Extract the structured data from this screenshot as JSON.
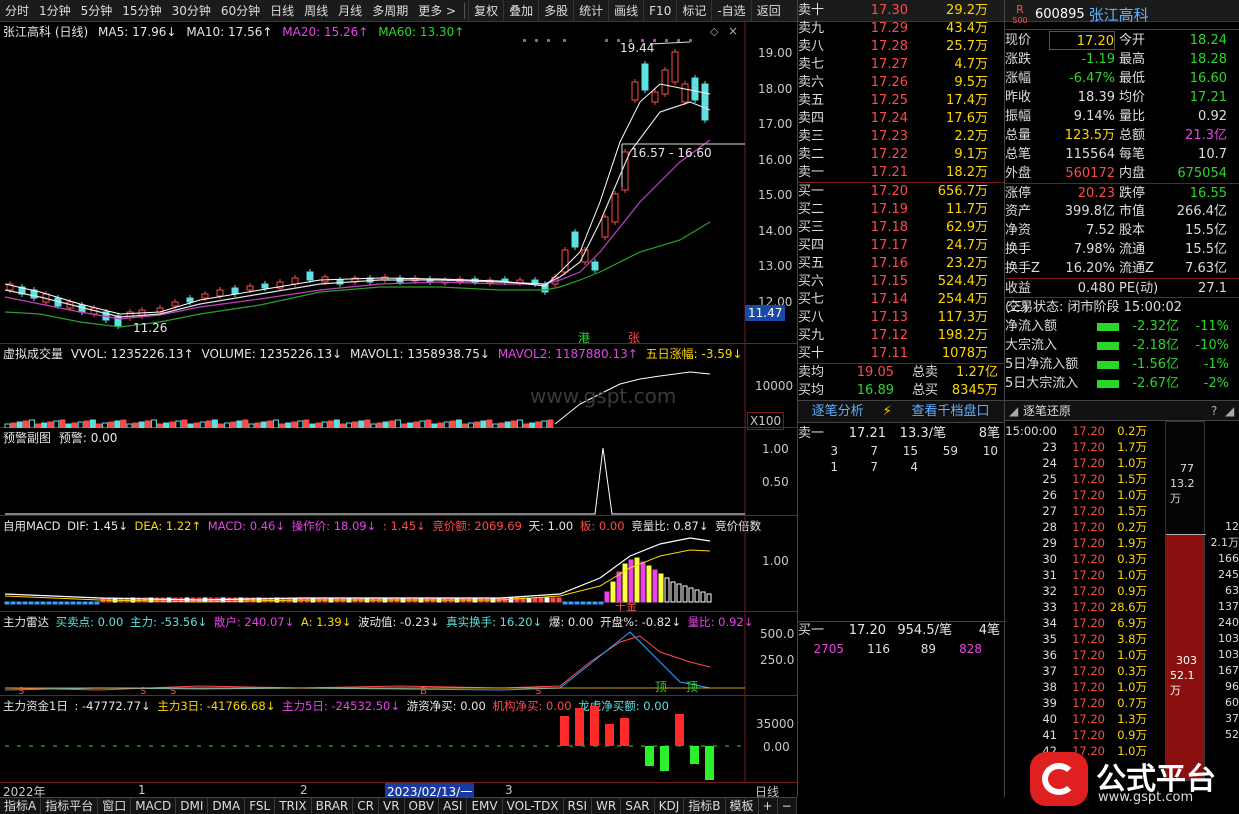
{
  "toolbar": {
    "periods": [
      "分时",
      "1分钟",
      "5分钟",
      "15分钟",
      "30分钟",
      "60分钟",
      "日线",
      "周线",
      "月线",
      "多周期",
      "更多 >"
    ],
    "actions": [
      "复权",
      "叠加",
      "多股",
      "统计",
      "画线",
      "F10",
      "标记",
      "-自选",
      "返回"
    ]
  },
  "main_chart": {
    "title": "张江高科 (日线)",
    "ma5": "MA5: 17.96↓",
    "ma10": "MA10: 17.56↑",
    "ma20": "MA20: 15.26↑",
    "ma60": "MA60: 13.30↑",
    "high_label": "19.44",
    "range_label": "16.57 - 16.60",
    "low_label": "11.26",
    "current_price_tag": "11.47",
    "badge1": "港",
    "badge2": "张",
    "y_ticks": [
      "19.00",
      "18.00",
      "17.00",
      "16.00",
      "15.00",
      "14.00",
      "13.00",
      "12.00"
    ]
  },
  "volume_panel": {
    "title": "虚拟成交量",
    "vvol": "VVOL: 1235226.13↑",
    "volume": "VOLUME: 1235226.13↓",
    "mavol1": "MAVOL1: 1358938.75↓",
    "mavol2": "MAVOL2: 1187880.13↑",
    "five_day": "五日涨幅: -3.59↓",
    "y_tick": "10000",
    "multiplier": "X100",
    "watermark": "www.gspt.com"
  },
  "alert_panel": {
    "title": "预警副图",
    "value": "预警: 0.00",
    "y_ticks": [
      "1.00",
      "0.50"
    ]
  },
  "macd_panel": {
    "title": "自用MACD",
    "dif": "DIF: 1.45↓",
    "dea": "DEA: 1.22↑",
    "macd": "MACD: 0.46↓",
    "op_price": "操作价: 18.09↓",
    "x1": ": 1.45↓",
    "bid_amount": "竞价额: 2069.69",
    "day": "天: 1.00",
    "board": "板: 0.00",
    "vol_ratio": "竞量比: 0.87↓",
    "bid_mult": "竞价倍数",
    "y_tick": "1.00",
    "tag": "千金"
  },
  "radar_panel": {
    "title": "主力雷达",
    "buy_sell": "买卖点: 0.00",
    "main": "主力: -53.56↓",
    "retail": "散户: 240.07↓",
    "a": "A: 1.39↓",
    "wave": "波动值: -0.23↓",
    "real_turnover": "真实换手: 16.20↓",
    "burst": "爆: 0.00",
    "open_pct": "开盘%: -0.82↓",
    "vol_ratio": "量比: 0.92↓",
    "y_ticks": [
      "500.0",
      "250.0"
    ],
    "sign": "顶"
  },
  "fund_panel": {
    "title": "主力资金1日",
    "d1": ": -47772.77↓",
    "d3": "主力3日: -41766.68↓",
    "d5": "主力5日: -24532.50↓",
    "hot": "游资净买: 0.00",
    "inst": "机构净买: 0.00",
    "dragon": "龙虎净买额: 0.00",
    "y_ticks": [
      "35000",
      "0.00"
    ]
  },
  "x_axis": {
    "year": "2022年",
    "m1": "1",
    "m2": "2",
    "cursor_date": "2023/02/13/一",
    "m3": "3",
    "period": "日线"
  },
  "orderbook": {
    "sells": [
      {
        "name": "卖十",
        "price": "17.30",
        "vol": "29.2万"
      },
      {
        "name": "卖九",
        "price": "17.29",
        "vol": "43.4万"
      },
      {
        "name": "卖八",
        "price": "17.28",
        "vol": "25.7万"
      },
      {
        "name": "卖七",
        "price": "17.27",
        "vol": "4.7万"
      },
      {
        "name": "卖六",
        "price": "17.26",
        "vol": "9.5万"
      },
      {
        "name": "卖五",
        "price": "17.25",
        "vol": "17.4万"
      },
      {
        "name": "卖四",
        "price": "17.24",
        "vol": "17.6万"
      },
      {
        "name": "卖三",
        "price": "17.23",
        "vol": "2.2万"
      },
      {
        "name": "卖二",
        "price": "17.22",
        "vol": "9.1万"
      },
      {
        "name": "卖一",
        "price": "17.21",
        "vol": "18.2万"
      }
    ],
    "buys": [
      {
        "name": "买一",
        "price": "17.20",
        "vol": "656.7万"
      },
      {
        "name": "买二",
        "price": "17.19",
        "vol": "11.7万"
      },
      {
        "name": "买三",
        "price": "17.18",
        "vol": "62.9万"
      },
      {
        "name": "买四",
        "price": "17.17",
        "vol": "24.7万"
      },
      {
        "name": "买五",
        "price": "17.16",
        "vol": "23.2万"
      },
      {
        "name": "买六",
        "price": "17.15",
        "vol": "524.4万"
      },
      {
        "name": "买七",
        "price": "17.14",
        "vol": "254.4万"
      },
      {
        "name": "买八",
        "price": "17.13",
        "vol": "117.3万"
      },
      {
        "name": "买九",
        "price": "17.12",
        "vol": "198.2万"
      },
      {
        "name": "买十",
        "price": "17.11",
        "vol": "1078万"
      }
    ],
    "avg_sell_label": "卖均",
    "avg_sell": "19.05",
    "total_sell_label": "总卖",
    "total_sell": "1.27亿",
    "avg_buy_label": "买均",
    "avg_buy": "16.89",
    "total_buy_label": "总买",
    "total_buy": "8345万"
  },
  "stock_info": {
    "code": "600895",
    "name": "张江高科",
    "r_badge": "R",
    "r_sub": "500",
    "rows": [
      {
        "k1": "现价",
        "v1": "17.20",
        "k2": "今开",
        "v2": "18.24"
      },
      {
        "k1": "涨跌",
        "v1": "-1.19",
        "k2": "最高",
        "v2": "18.28"
      },
      {
        "k1": "涨幅",
        "v1": "-6.47%",
        "k2": "最低",
        "v2": "16.60"
      },
      {
        "k1": "昨收",
        "v1": "18.39",
        "k2": "均价",
        "v2": "17.21"
      },
      {
        "k1": "振幅",
        "v1": "9.14%",
        "k2": "量比",
        "v2": "0.92"
      },
      {
        "k1": "总量",
        "v1": "123.5万",
        "k2": "总额",
        "v2": "21.3亿"
      },
      {
        "k1": "总笔",
        "v1": "115564",
        "k2": "每笔",
        "v2": "10.7"
      },
      {
        "k1": "外盘",
        "v1": "560172",
        "k2": "内盘",
        "v2": "675054"
      },
      {
        "k1": "涨停",
        "v1": "20.23",
        "k2": "跌停",
        "v2": "16.55"
      },
      {
        "k1": "资产",
        "v1": "399.8亿",
        "k2": "市值",
        "v2": "266.4亿"
      },
      {
        "k1": "净资",
        "v1": "7.52",
        "k2": "股本",
        "v2": "15.5亿"
      },
      {
        "k1": "换手",
        "v1": "7.98%",
        "k2": "流通",
        "v2": "15.5亿"
      },
      {
        "k1": "换手Z",
        "v1": "16.20%",
        "k2": "流通Z",
        "v2": "7.63亿"
      },
      {
        "k1": "收益(三)",
        "v1": "0.480",
        "k2": "PE(动)",
        "v2": "27.1"
      }
    ],
    "trade_status": "交易状态: 闭市阶段 15:00:02",
    "flows": [
      {
        "label": "净流入额",
        "val": "-2.32亿",
        "pct": "-11%"
      },
      {
        "label": "大宗流入",
        "val": "-2.18亿",
        "pct": "-10%"
      },
      {
        "label": "5日净流入额",
        "val": "-1.56亿",
        "pct": "-1%"
      },
      {
        "label": "5日大宗流入",
        "val": "-2.67亿",
        "pct": "-2%"
      }
    ]
  },
  "tick_analysis": {
    "tab1": "逐笔分析",
    "tab2": "查看千档盘口",
    "sell1_label": "卖一",
    "sell1_price": "17.21",
    "sell1_vol": "13.3/笔",
    "sell1_count": "8笔",
    "sell_queue1": [
      "3",
      "7",
      "15",
      "59",
      "10"
    ],
    "sell_queue2": [
      "1",
      "7",
      "4"
    ],
    "buy1_label": "买一",
    "buy1_price": "17.20",
    "buy1_vol": "954.5/笔",
    "buy1_count": "4笔",
    "buy_queue": [
      "2705",
      "116",
      "89",
      "828"
    ]
  },
  "tick_restore": {
    "title": "逐笔还原",
    "rows": [
      {
        "t": "15:00:00",
        "p": "17.20",
        "v": "0.2万"
      },
      {
        "t": "23",
        "p": "17.20",
        "v": "1.7万"
      },
      {
        "t": "24",
        "p": "17.20",
        "v": "1.0万"
      },
      {
        "t": "25",
        "p": "17.20",
        "v": "1.5万"
      },
      {
        "t": "26",
        "p": "17.20",
        "v": "1.0万"
      },
      {
        "t": "27",
        "p": "17.20",
        "v": "1.5万"
      },
      {
        "t": "28",
        "p": "17.20",
        "v": "0.2万"
      },
      {
        "t": "29",
        "p": "17.20",
        "v": "1.9万"
      },
      {
        "t": "30",
        "p": "17.20",
        "v": "0.3万"
      },
      {
        "t": "31",
        "p": "17.20",
        "v": "1.0万"
      },
      {
        "t": "32",
        "p": "17.20",
        "v": "0.9万"
      },
      {
        "t": "33",
        "p": "17.20",
        "v": "28.6万"
      },
      {
        "t": "34",
        "p": "17.20",
        "v": "6.9万"
      },
      {
        "t": "35",
        "p": "17.20",
        "v": "3.8万"
      },
      {
        "t": "36",
        "p": "17.20",
        "v": "1.0万"
      },
      {
        "t": "37",
        "p": "17.20",
        "v": "0.3万"
      },
      {
        "t": "38",
        "p": "17.20",
        "v": "1.0万"
      },
      {
        "t": "39",
        "p": "17.20",
        "v": "0.7万"
      },
      {
        "t": "40",
        "p": "17.20",
        "v": "1.3万"
      },
      {
        "t": "41",
        "p": "17.20",
        "v": "0.9万"
      },
      {
        "t": "42",
        "p": "17.20",
        "v": "1.0万"
      }
    ],
    "bar_top_count": "77",
    "bar_top_vol": "13.2万",
    "bar_bottom_count": "303",
    "bar_bottom_vol": "52.1万",
    "side_numbers": [
      "12",
      "2.1万",
      "166",
      "245",
      "63",
      "137",
      "240",
      "103",
      "103",
      "167",
      "96",
      "60",
      "37",
      "52"
    ]
  },
  "bottom_tabs": [
    "指标A",
    "指标平台",
    "窗口",
    "MACD",
    "DMI",
    "DMA",
    "FSL",
    "TRIX",
    "BRAR",
    "CR",
    "VR",
    "OBV",
    "ASI",
    "EMV",
    "VOL-TDX",
    "RSI",
    "WR",
    "SAR",
    "KDJ",
    "指标B",
    "模板",
    "+",
    "−"
  ],
  "logo": {
    "text": "公式平台",
    "url_text": "www.gspt.com"
  }
}
